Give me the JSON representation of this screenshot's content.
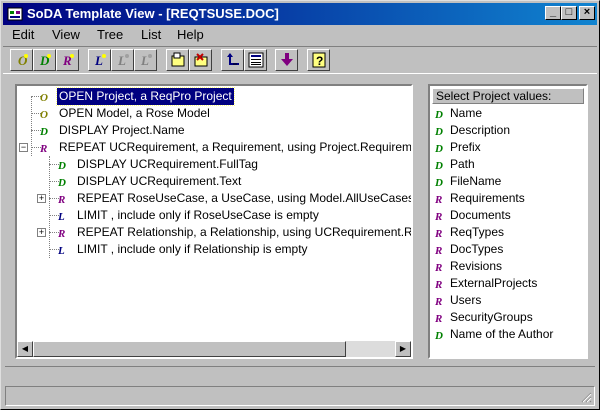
{
  "window": {
    "title": "SoDA Template View - [REQTSUSE.DOC]",
    "minimize": "_",
    "maximize": "□",
    "close": "×"
  },
  "menu": [
    {
      "label": "Edit"
    },
    {
      "label": "View"
    },
    {
      "label": "Tree"
    },
    {
      "label": "List"
    },
    {
      "label": "Help"
    }
  ],
  "toolbar": {
    "buttons": [
      {
        "icon": "open-icon"
      },
      {
        "icon": "display-icon"
      },
      {
        "icon": "repeat-icon"
      },
      {
        "icon": "limit-icon"
      },
      {
        "icon": "limit-disabled-icon"
      },
      {
        "icon": "limit-disabled-2-icon"
      },
      {
        "icon": "insert-icon"
      },
      {
        "icon": "delete-icon"
      },
      {
        "icon": "return-icon"
      },
      {
        "icon": "list-icon"
      },
      {
        "icon": "down-arrow-icon"
      },
      {
        "icon": "help-icon"
      }
    ]
  },
  "tree": {
    "nodes": [
      {
        "icon": "O",
        "text": "OPEN Project, a ReqPro Project",
        "selected": true
      },
      {
        "icon": "O",
        "text": "OPEN Model, a Rose Model"
      },
      {
        "icon": "D",
        "text": "DISPLAY Project.Name"
      },
      {
        "icon": "R",
        "text": "REPEAT UCRequirement, a Requirement, using Project.Requirements"
      },
      {
        "icon": "D",
        "text": "DISPLAY UCRequirement.FullTag"
      },
      {
        "icon": "D",
        "text": "DISPLAY UCRequirement.Text"
      },
      {
        "icon": "R",
        "text": "REPEAT RoseUseCase, a UseCase, using Model.AllUseCases"
      },
      {
        "icon": "L",
        "text": "LIMIT , include only if RoseUseCase is empty"
      },
      {
        "icon": "R",
        "text": "REPEAT Relationship, a Relationship, using UCRequirement.Relationships"
      },
      {
        "icon": "L",
        "text": "LIMIT , include only if Relationship is empty"
      }
    ]
  },
  "values": {
    "header": "Select Project values:",
    "items": [
      {
        "icon": "D",
        "text": "Name"
      },
      {
        "icon": "D",
        "text": "Description"
      },
      {
        "icon": "D",
        "text": "Prefix"
      },
      {
        "icon": "D",
        "text": "Path"
      },
      {
        "icon": "D",
        "text": "FileName"
      },
      {
        "icon": "R",
        "text": "Requirements"
      },
      {
        "icon": "R",
        "text": "Documents"
      },
      {
        "icon": "R",
        "text": "ReqTypes"
      },
      {
        "icon": "R",
        "text": "DocTypes"
      },
      {
        "icon": "R",
        "text": "Revisions"
      },
      {
        "icon": "R",
        "text": "ExternalProjects"
      },
      {
        "icon": "R",
        "text": "Users"
      },
      {
        "icon": "R",
        "text": "SecurityGroups"
      },
      {
        "icon": "D",
        "text": "Name of the Author"
      }
    ]
  },
  "colors": {
    "title_start": "#000080",
    "title_end": "#1084d0",
    "open_icon": "#808000",
    "display_icon": "#008000",
    "repeat_icon": "#800080",
    "limit_icon": "#000080"
  }
}
